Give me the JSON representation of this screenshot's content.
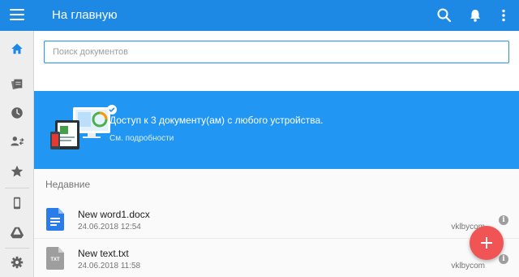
{
  "header": {
    "title": "На главную",
    "icons": [
      "menu-icon",
      "search-icon",
      "bell-icon",
      "more-vertical-icon"
    ]
  },
  "rail": {
    "items": [
      "home-icon",
      "stacked-documents-icon",
      "clock-icon",
      "shared-users-icon",
      "star-icon",
      "phone-icon",
      "drive-icon",
      "gear-icon"
    ]
  },
  "search": {
    "placeholder": "Поиск документов",
    "value": ""
  },
  "banner": {
    "headline": "Доступ к 3 документу(ам) с любого устройства.",
    "link": "См. подробности"
  },
  "recent": {
    "title": "Недавние",
    "files": [
      {
        "name": "New word1.docx",
        "date": "24.06.2018 12:54",
        "owner": "vklbycom",
        "icon": "word-doc-icon"
      },
      {
        "name": "New text.txt",
        "date": "24.06.2018 11:58",
        "owner": "vklbycom",
        "icon": "txt-file-icon",
        "badge": "TXT"
      }
    ]
  },
  "colors": {
    "accent": "#1e88e5",
    "banner": "#2196f3",
    "fab": "#f05454"
  }
}
